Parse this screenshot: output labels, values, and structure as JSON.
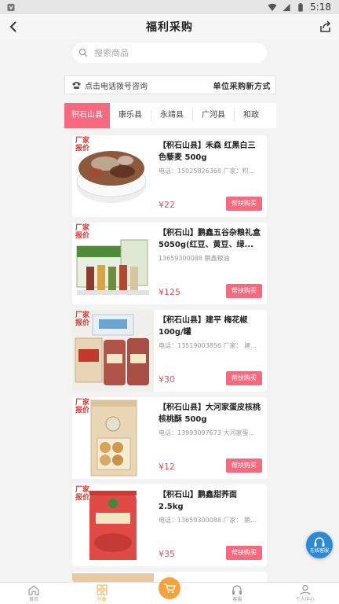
{
  "status_bar": {
    "time": "5:18"
  },
  "header": {
    "title": "福利采购"
  },
  "search": {
    "placeholder": "搜索商品"
  },
  "banner": {
    "call_text": "点击电话拨号咨询",
    "mode_text": "单位采购新方式"
  },
  "tabs": [
    {
      "label": "积石山县",
      "active": true
    },
    {
      "label": "康乐县",
      "active": false
    },
    {
      "label": "永靖县",
      "active": false
    },
    {
      "label": "广河县",
      "active": false
    },
    {
      "label": "和政",
      "active": false
    }
  ],
  "products": [
    {
      "badge": "厂家报价",
      "title": "【积石山县】禾森 红黑白三色藜麦 500g",
      "meta": "电话：15025826368 厂家：积...",
      "price": "¥22",
      "buy_label": "帮扶购买"
    },
    {
      "badge": "厂家报价",
      "title": "【积石山】鹏鑫五谷杂粮礼盒5050g(红豆、黄豆、绿...",
      "meta": "13659300088 鹏鑫粮油",
      "price": "¥125",
      "buy_label": "帮扶购买"
    },
    {
      "badge": "厂家报价",
      "title": "【积石山县】建平 梅花椒 100g/罐",
      "meta": "电话：13519003856 厂家： 建...",
      "price": "¥30",
      "buy_label": "帮扶购买"
    },
    {
      "badge": "厂家报价",
      "title": "【积石山县】大河家蛋皮核桃 核桃酥 500g",
      "meta": "电话：13993097673 大河家蛋...",
      "price": "¥12",
      "buy_label": "帮扶购买"
    },
    {
      "badge": "厂家报价",
      "title": "【积石山】鹏鑫甜荞面 2.5kg",
      "meta": "电话：13659300088 厂家： 鹏...",
      "price": "¥35",
      "buy_label": "帮扶购买"
    }
  ],
  "float_service": {
    "label": "在线客服"
  },
  "bottom_nav": [
    {
      "label": "首页",
      "active": false
    },
    {
      "label": "分类",
      "active": true
    },
    {
      "label": "",
      "active": false
    },
    {
      "label": "客服",
      "active": false
    },
    {
      "label": "个人中心",
      "active": false
    }
  ],
  "colors": {
    "accent": "#f7697f",
    "price": "#e84f5e",
    "badge": "#e73232",
    "cart": "#f7a23b"
  }
}
